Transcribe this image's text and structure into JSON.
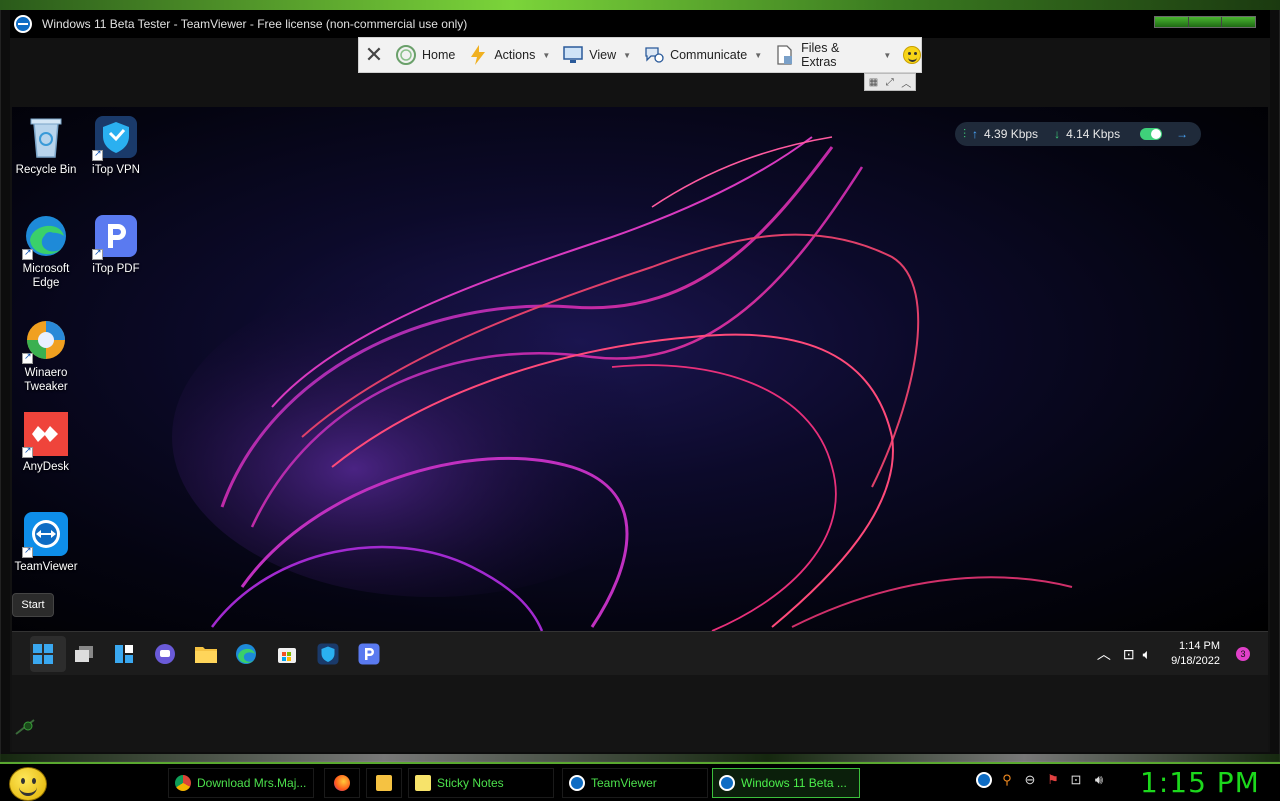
{
  "window": {
    "title": "Windows 11 Beta Tester - TeamViewer - Free license (non-commercial use only)"
  },
  "toolbar": {
    "home": "Home",
    "actions": "Actions",
    "view": "View",
    "communicate": "Communicate",
    "files_extras": "Files & Extras"
  },
  "remote": {
    "desktop_icons": [
      {
        "label": "Recycle Bin"
      },
      {
        "label": "iTop VPN"
      },
      {
        "label": "Microsoft Edge"
      },
      {
        "label": "iTop PDF"
      },
      {
        "label": "Winaero Tweaker"
      },
      {
        "label": "AnyDesk"
      },
      {
        "label": "TeamViewer"
      }
    ],
    "network": {
      "upload": "4.39 Kbps",
      "download": "4.14 Kbps"
    },
    "start_tooltip": "Start",
    "tray": {
      "time": "1:14 PM",
      "date": "9/18/2022",
      "notifications": "3"
    }
  },
  "host_taskbar": {
    "items": [
      {
        "label": "Download Mrs.Maj..."
      },
      {
        "label": "Sticky Notes"
      },
      {
        "label": "TeamViewer"
      },
      {
        "label": "Windows 11 Beta ..."
      }
    ],
    "clock": "1:15 PM"
  },
  "colors": {
    "accent_green": "#1cd81c",
    "teamviewer_blue": "#0e6cc4",
    "taskbar_text": "#4ce04c"
  }
}
